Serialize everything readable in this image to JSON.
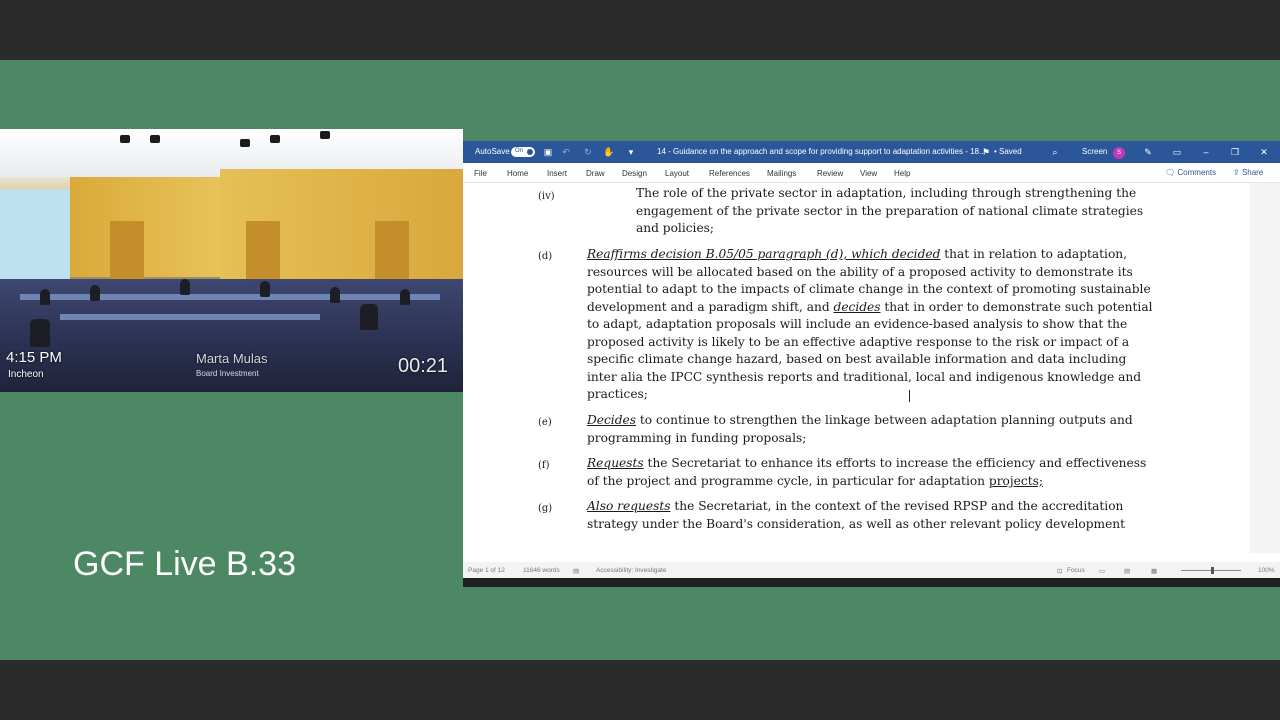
{
  "video": {
    "time": "4:15 PM",
    "location": "Incheon",
    "speaker_name": "Marta Mulas",
    "speaker_role": "Board Investment",
    "timer": "00:21"
  },
  "live_label": "GCF Live B.33",
  "word": {
    "autosave_label": "AutoSave",
    "autosave_state": "On",
    "doc_title": "14 - Guidance on the approach and scope for providing support to adaptation activities - 18...",
    "saved_status": "• Saved",
    "screen_label": "Screen",
    "avatar_initial": "S",
    "menu": [
      "File",
      "Home",
      "Insert",
      "Draw",
      "Design",
      "Layout",
      "References",
      "Mailings",
      "Review",
      "View",
      "Help"
    ],
    "comments_label": "Comments",
    "share_label": "Share",
    "status": {
      "page": "Page 1 of 12",
      "words": "11646 words",
      "accessibility": "Accessibility: Investigate",
      "focus": "Focus",
      "zoom": "100%"
    }
  },
  "document": {
    "item_iv_label": "(iv)",
    "item_iv_text": "The role of the private sector in adaptation, including through strengthening the engagement of the private sector in the preparation of national climate strategies and policies;",
    "item_d_label": "(d)",
    "item_d_lead": "Reaffirms decision B.05/05 paragraph (d), which decided",
    "item_d_text1": " that in relation to adaptation, resources will be allocated based on the ability of a proposed activity to demonstrate its potential to adapt to the impacts of climate change in the context of promoting sustainable development and a paradigm shift, and ",
    "item_d_decides": "decides",
    "item_d_text2": " that in order to demonstrate such potential to adapt, adaptation proposals will include an evidence-based analysis to show that the proposed activity is likely to be an effective adaptive response to the risk or impact of a specific climate change hazard, based on best available information and data including inter alia the IPCC synthesis reports and traditional, local and indigenous knowledge and practices;",
    "item_e_label": "(e)",
    "item_e_lead": "Decides",
    "item_e_text": " to continue to strengthen the linkage between adaptation planning outputs and programming in funding proposals;",
    "item_f_label": "(f)",
    "item_f_lead": "Requests",
    "item_f_text": " the Secretariat to enhance its efforts to increase the efficiency and effectiveness of the project and programme cycle, in particular for adaptation ",
    "item_f_projects": "projects;",
    "item_g_label": "(g)",
    "item_g_lead": "Also requests",
    "item_g_text": " the Secretariat, in the context of the revised RPSP and the accreditation strategy under the Board's consideration, as well as other relevant policy development"
  }
}
